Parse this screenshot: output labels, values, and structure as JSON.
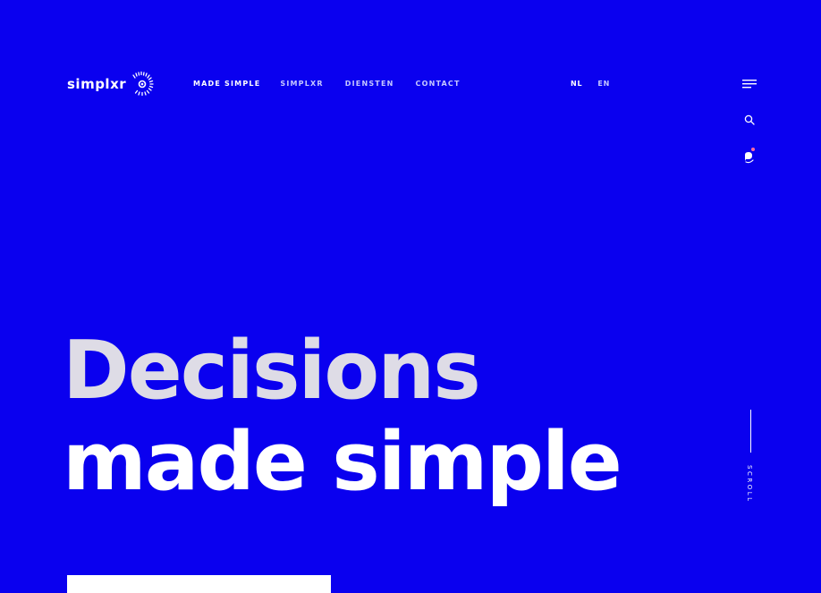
{
  "brand": {
    "name": "simplxr",
    "mark_icon": "simplxr-logo-mark-icon"
  },
  "nav": {
    "items": [
      {
        "label": "MADE SIMPLE",
        "active": true
      },
      {
        "label": "SIMPLXR",
        "active": false
      },
      {
        "label": "DIENSTEN",
        "active": false
      },
      {
        "label": "CONTACT",
        "active": false
      }
    ]
  },
  "language": {
    "options": [
      {
        "label": "NL",
        "active": true
      },
      {
        "label": "EN",
        "active": false
      }
    ]
  },
  "tools": {
    "menu_icon": "menu-icon",
    "search_icon": "search-icon",
    "chat_icon": "chat-icon"
  },
  "hero": {
    "line1": "Decisions",
    "line2": "made simple"
  },
  "scroll": {
    "label": "SCROLL"
  },
  "colors": {
    "background": "#0a00ef",
    "hero_line1": "#dedce6",
    "hero_line2": "#ffffff",
    "nav_muted": "#c6c8ff",
    "chat_dot": "#ff6aa0"
  }
}
